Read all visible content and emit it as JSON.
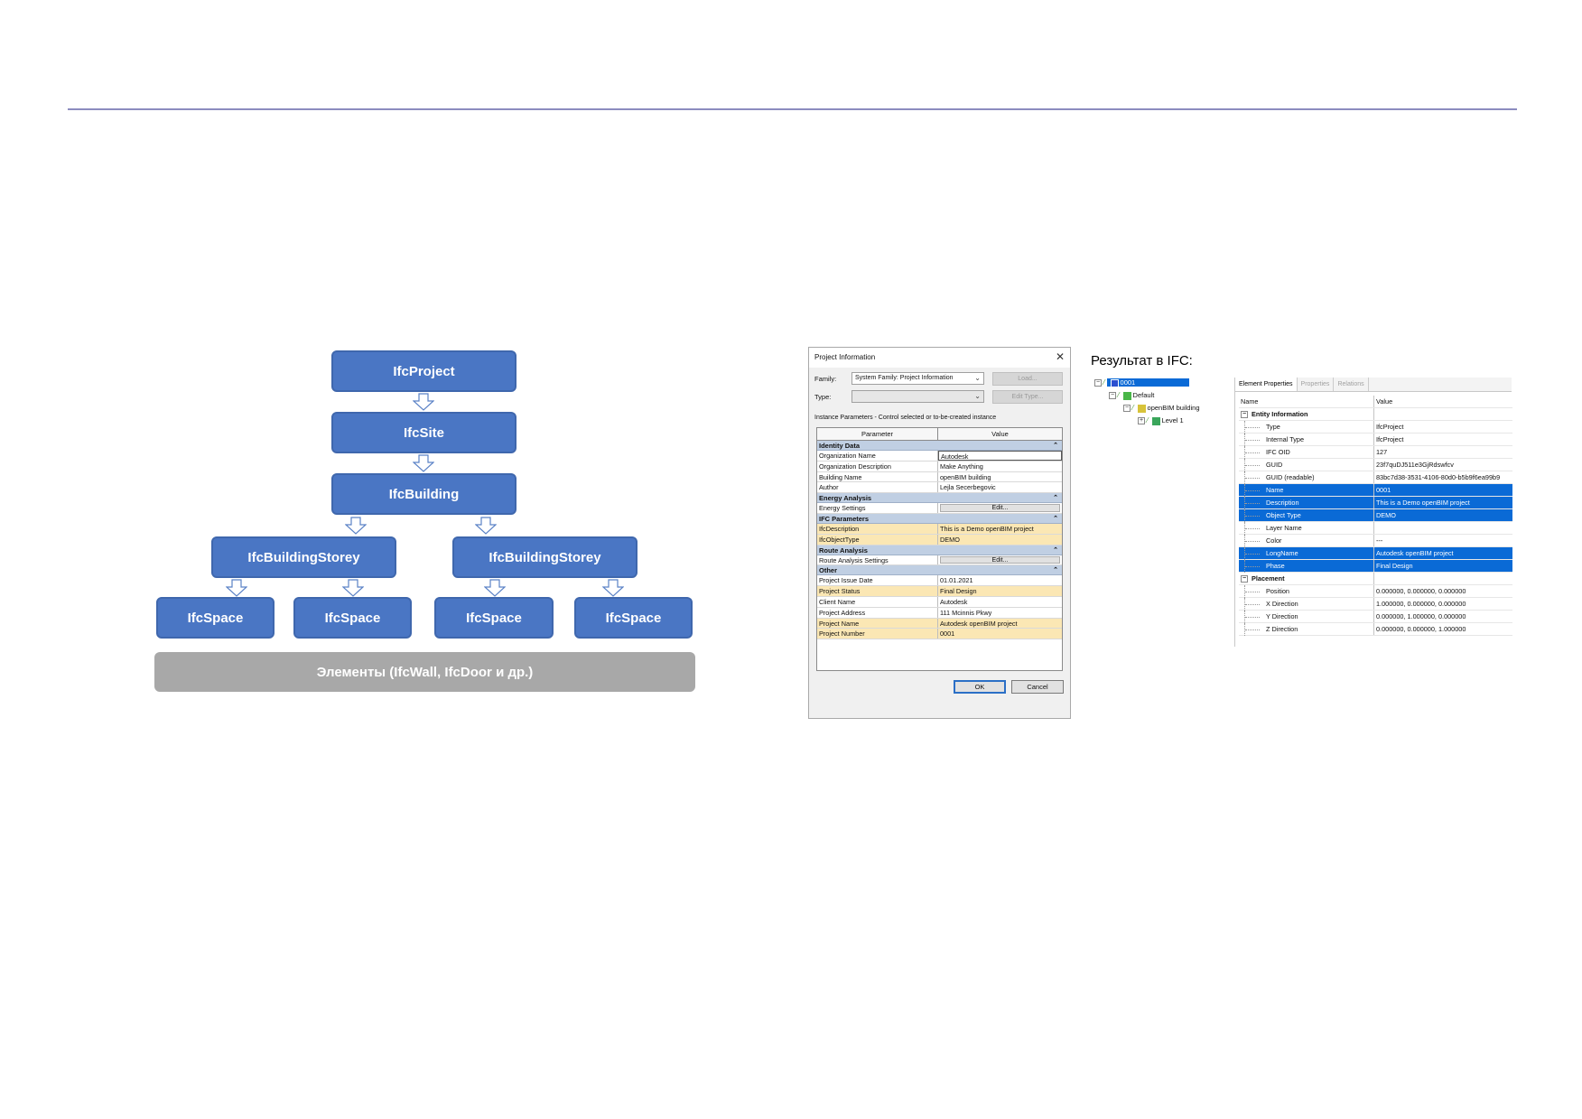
{
  "diagram": {
    "project": "IfcProject",
    "site": "IfcSite",
    "building": "IfcBuilding",
    "storeys": [
      "IfcBuildingStorey",
      "IfcBuildingStorey"
    ],
    "spaces": [
      "IfcSpace",
      "IfcSpace",
      "IfcSpace",
      "IfcSpace"
    ],
    "elements": "Элементы (IfcWall, IfcDoor и др.)"
  },
  "dialog": {
    "title": "Project Information",
    "family_label": "Family:",
    "family_value": "System Family: Project Information",
    "type_label": "Type:",
    "type_value": "",
    "load_button": "Load...",
    "edit_type_button": "Edit Type...",
    "instance_caption": "Instance Parameters - Control selected or to-be-created instance",
    "col_parameter": "Parameter",
    "col_value": "Value",
    "groups": [
      {
        "name": "Identity Data",
        "rows": [
          {
            "p": "Organization Name",
            "v": "Autodesk"
          },
          {
            "p": "Organization Description",
            "v": "Make Anything"
          },
          {
            "p": "Building Name",
            "v": "openBIM building"
          },
          {
            "p": "Author",
            "v": "Lejla Secerbegovic"
          }
        ]
      },
      {
        "name": "Energy Analysis",
        "rows": [
          {
            "p": "Energy Settings",
            "v": "Edit..."
          }
        ]
      },
      {
        "name": "IFC Parameters",
        "rows": [
          {
            "p": "IfcDescription",
            "v": "This is a Demo openBIM project"
          },
          {
            "p": "IfcObjectType",
            "v": "DEMO"
          }
        ]
      },
      {
        "name": "Route Analysis",
        "rows": [
          {
            "p": "Route Analysis Settings",
            "v": "Edit..."
          }
        ]
      },
      {
        "name": "Other",
        "rows": [
          {
            "p": "Project Issue Date",
            "v": "01.01.2021"
          },
          {
            "p": "Project Status",
            "v": "Final Design"
          },
          {
            "p": "Client Name",
            "v": "Autodesk"
          },
          {
            "p": "Project Address",
            "v": "111 Mcinnis Pkwy"
          },
          {
            "p": "Project Name",
            "v": "Autodesk openBIM project"
          },
          {
            "p": "Project Number",
            "v": "0001"
          }
        ]
      }
    ],
    "ok_button": "OK",
    "cancel_button": "Cancel"
  },
  "result": {
    "title": "Результат в IFC:",
    "tree": [
      "0001",
      "Default",
      "openBIM building",
      "Level 1"
    ],
    "tabs": [
      "Element Properties",
      "Properties",
      "Relations"
    ],
    "col_name": "Name",
    "col_value": "Value",
    "entity_section": "Entity Information",
    "entity_rows": [
      {
        "n": "Type",
        "v": "IfcProject"
      },
      {
        "n": "Internal Type",
        "v": "IfcProject"
      },
      {
        "n": "IFC OID",
        "v": "127"
      },
      {
        "n": "GUID",
        "v": "23f7quDJ511e3GjRdswfcv"
      },
      {
        "n": "GUID (readable)",
        "v": "83bc7d38-3531-4106-80d0-b5b9f6ea99b9"
      },
      {
        "n": "Name",
        "v": "0001"
      },
      {
        "n": "Description",
        "v": "This is a Demo openBIM project"
      },
      {
        "n": "Object Type",
        "v": "DEMO"
      },
      {
        "n": "Layer Name",
        "v": ""
      },
      {
        "n": "Color",
        "v": "---"
      },
      {
        "n": "LongName",
        "v": "Autodesk openBIM project"
      },
      {
        "n": "Phase",
        "v": "Final Design"
      }
    ],
    "placement_section": "Placement",
    "placement_rows": [
      {
        "n": "Position",
        "v": "0.000000, 0.000000, 0.000000"
      },
      {
        "n": "X Direction",
        "v": "1.000000, 0.000000, 0.000000"
      },
      {
        "n": "Y Direction",
        "v": "0.000000, 1.000000, 0.000000"
      },
      {
        "n": "Z Direction",
        "v": "0.000000, 0.000000, 1.000000"
      }
    ]
  },
  "colors": {
    "node": "#4a76c4",
    "elements_bar": "#a8a8a8",
    "selection": "#0a6ad6",
    "ifc_highlight": "#fbe7b4"
  }
}
